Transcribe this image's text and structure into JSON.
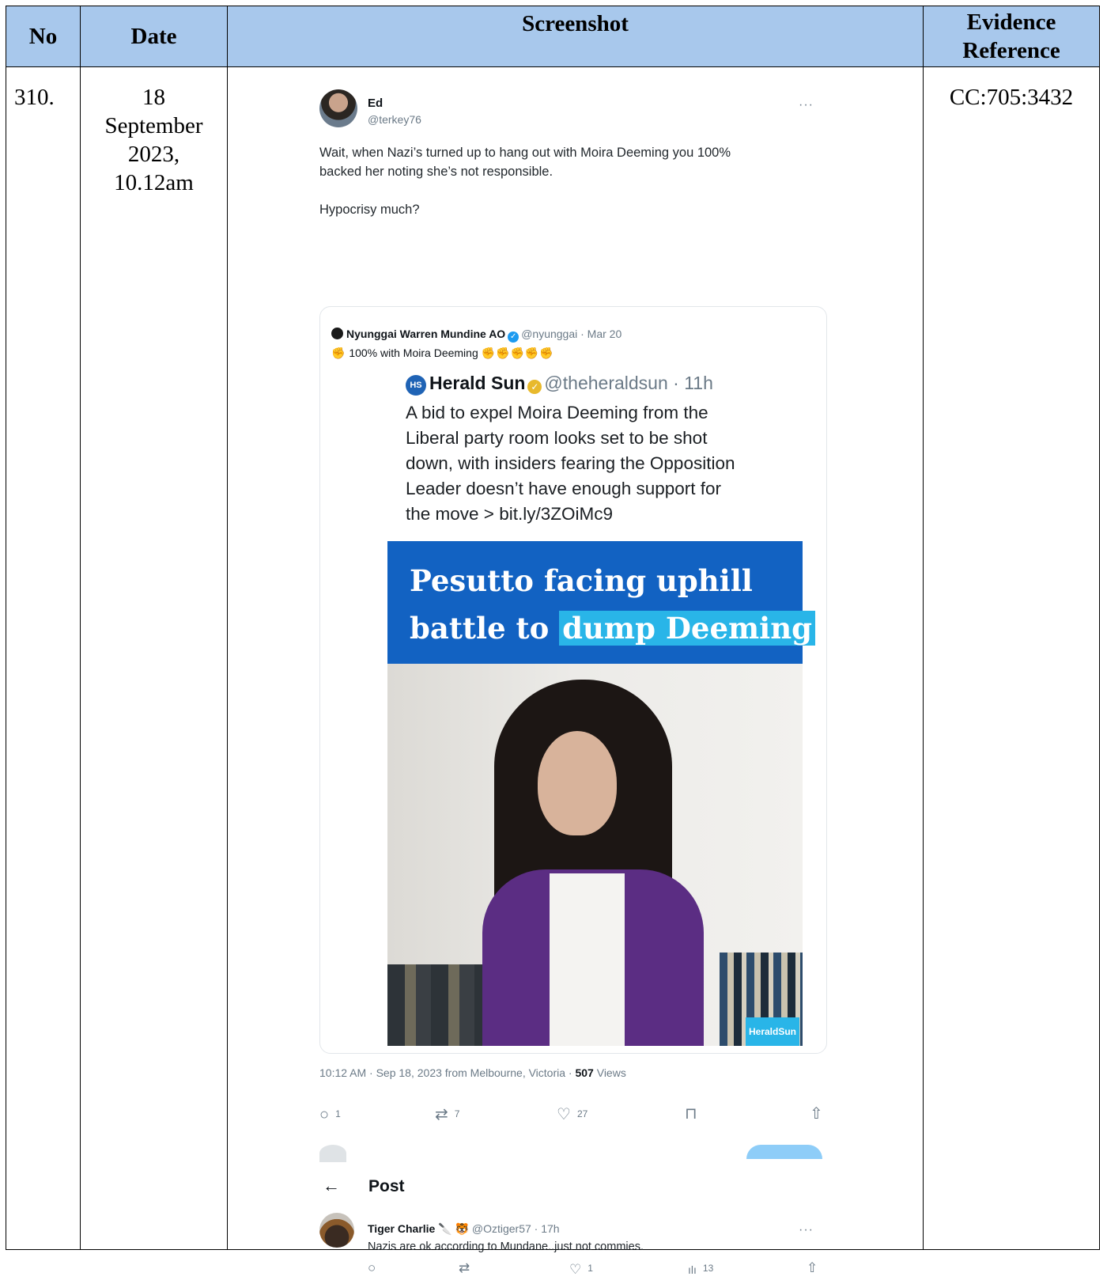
{
  "table": {
    "headers": {
      "no": "No",
      "date": "Date",
      "screenshot": "Screenshot",
      "evidence_reference": "Evidence Reference"
    },
    "row": {
      "no": "310.",
      "date_lines": [
        "18",
        "September",
        "2023,",
        "10.12am"
      ],
      "evidence_reference": "CC:705:3432"
    }
  },
  "tweet": {
    "author_name": "Ed",
    "author_handle": "@terkey76",
    "more": "···",
    "text_line1": "Wait, when Nazi’s turned up to hang out with Moira Deeming you 100%",
    "text_line2": "backed her noting she’s not responsible.",
    "text_line3": "Hypocrisy much?",
    "quoted": {
      "name": "Nyunggai Warren Mundine AO",
      "handle_time": "@nyunggai · Mar 20",
      "text": "100% with Moira Deeming",
      "fists_leading": "✊",
      "fists_trailing": "✊✊✊✊✊",
      "nested": {
        "logo": "HS",
        "name": "Herald Sun",
        "handle_time": "@theheraldsun · 11h",
        "lines": [
          "A bid to expel Moira Deeming from the",
          "Liberal party room looks set to be shot",
          "down, with insiders fearing the Opposition",
          "Leader doesn’t have enough support for",
          "the move > bit.ly/3ZOiMc9"
        ],
        "headline_line1": "Pesutto facing uphill",
        "headline_line2_plain": "battle to ",
        "headline_line2_highlight": "dump Deeming",
        "watermark": "HeraldSun"
      }
    },
    "meta_prefix": "10:12 AM · Sep 18, 2023 from Melbourne, Victoria · ",
    "views_count": "507",
    "views_label": " Views",
    "actions": {
      "reply": "1",
      "retweet": "7",
      "like": "27"
    },
    "post_header": {
      "back_arrow": "←",
      "title": "Post"
    },
    "reply": {
      "name": "Tiger Charlie",
      "badges": "🔪 🐯",
      "handle_time": "@Oztiger57 · 17h",
      "text": "Nazis are ok according to Mundane..just not commies.",
      "actions": {
        "like": "1",
        "views": "13"
      }
    }
  },
  "icons": {
    "reply": "○",
    "retweet": "⇄",
    "like": "♡",
    "bookmark": "⊓",
    "share": "⇧",
    "views": "ılı",
    "verified": "✓"
  }
}
